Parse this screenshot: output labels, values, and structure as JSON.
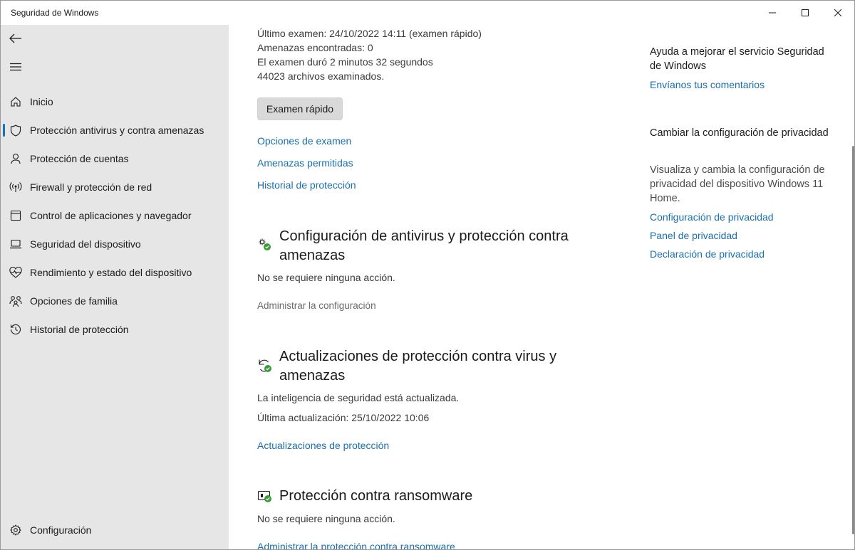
{
  "window": {
    "title": "Seguridad de Windows"
  },
  "sidebar": {
    "items": [
      {
        "label": "Inicio",
        "icon": "home-icon"
      },
      {
        "label": "Protección antivirus y contra amenazas",
        "icon": "shield-icon",
        "active": true
      },
      {
        "label": "Protección de cuentas",
        "icon": "person-icon"
      },
      {
        "label": "Firewall y protección de red",
        "icon": "wifi-antenna-icon"
      },
      {
        "label": "Control de aplicaciones y navegador",
        "icon": "browser-window-icon"
      },
      {
        "label": "Seguridad del dispositivo",
        "icon": "laptop-icon"
      },
      {
        "label": "Rendimiento y estado del dispositivo",
        "icon": "heartbeat-icon"
      },
      {
        "label": "Opciones de familia",
        "icon": "family-icon"
      },
      {
        "label": "Historial de protección",
        "icon": "history-icon"
      }
    ],
    "settings": {
      "label": "Configuración",
      "icon": "gear-icon"
    }
  },
  "scan": {
    "last_scan": "Último examen: 24/10/2022 14:11 (examen rápido)",
    "threats": "Amenazas encontradas: 0",
    "duration": "El examen duró 2 minutos 32 segundos",
    "files": "44023 archivos examinados.",
    "button": "Examen rápido",
    "links": [
      "Opciones de examen",
      "Amenazas permitidas",
      "Historial de protección"
    ]
  },
  "settings_section": {
    "title": "Configuración de antivirus y protección contra amenazas",
    "status": "No se requiere ninguna acción.",
    "link": "Administrar la configuración"
  },
  "updates_section": {
    "title": "Actualizaciones de protección contra virus y amenazas",
    "status": "La inteligencia de seguridad está actualizada.",
    "last_update": "Última actualización: 25/10/2022 10:06",
    "link": "Actualizaciones de protección"
  },
  "ransomware_section": {
    "title": "Protección contra ransomware",
    "status": "No se requiere ninguna acción.",
    "link": "Administrar la protección contra ransomware"
  },
  "right": {
    "help_title": "Ayuda a mejorar el servicio Seguridad de Windows",
    "feedback_link": "Envíanos tus comentarios",
    "privacy_title": "Cambiar la configuración de privacidad",
    "privacy_desc": "Visualiza y cambia la configuración de privacidad del dispositivo Windows 11 Home.",
    "privacy_links": [
      "Configuración de privacidad",
      "Panel de privacidad",
      "Declaración de privacidad"
    ]
  },
  "colors": {
    "accent": "#1a6fb0",
    "sidebar_bg": "#e6e6e6",
    "status_ok": "#3a9b3a"
  }
}
